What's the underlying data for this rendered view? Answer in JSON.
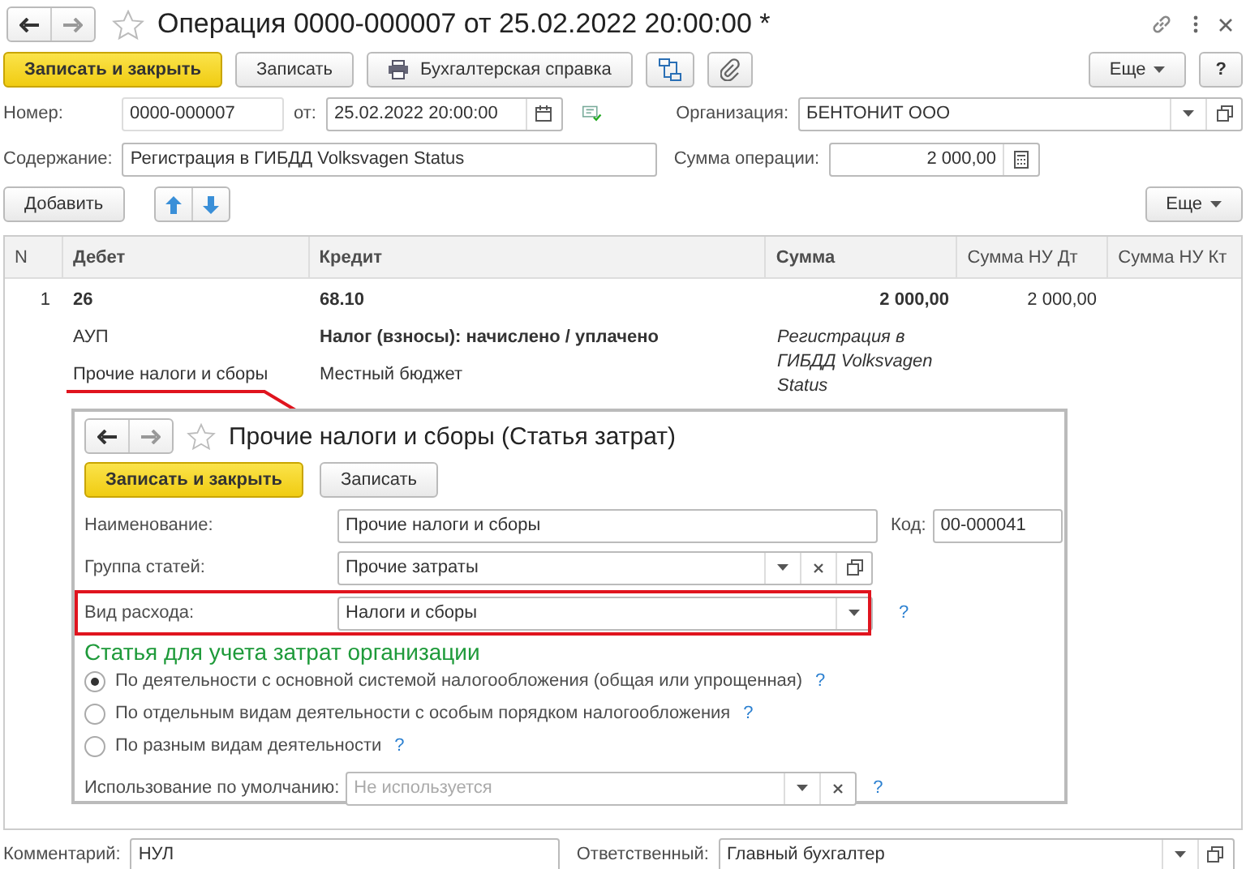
{
  "window": {
    "title": "Операция 0000-000007 от 25.02.2022 20:00:00 *"
  },
  "toolbar": {
    "buttons": [
      {
        "label": "Записать и закрыть",
        "kind": "primary"
      },
      {
        "label": "Записать",
        "kind": "plain"
      },
      {
        "label": "Бухгалтерская справка",
        "kind": "print"
      }
    ],
    "more": "Еще",
    "help": "?"
  },
  "header": {
    "number_label": "Номер:",
    "number": {
      "value": "0000-000007"
    },
    "date_label": "от:",
    "date": {
      "value": "25.02.2022 20:00:00"
    },
    "org_label": "Организация:",
    "org": {
      "value": "БЕНТОНИТ ООО"
    },
    "content_label": "Содержание:",
    "content": {
      "value": "Регистрация в ГИБДД Volksvagen Status"
    },
    "sum_label": "Сумма операции:",
    "sum": {
      "value": "2 000,00"
    }
  },
  "table_toolbar": {
    "add": "Добавить",
    "more": "Еще"
  },
  "table": {
    "columns": [
      "N",
      "Дебет",
      "Кредит",
      "Сумма",
      "Сумма НУ Дт",
      "Сумма НУ Кт"
    ],
    "rows": [
      {
        "n": "1",
        "debit": [
          "26",
          "АУП",
          "Прочие налоги и сборы"
        ],
        "credit": [
          "68.10",
          "Налог (взносы): начислено / уплачено",
          "Местный бюджет"
        ],
        "sum": "2 000,00",
        "description": "Регистрация в ГИБДД Volksvagen Status",
        "sum_nu_dt": "2 000,00"
      }
    ]
  },
  "dialog": {
    "title": "Прочие налоги и сборы (Статья затрат)",
    "buttons": [
      {
        "label": "Записать и закрыть",
        "kind": "primary"
      },
      {
        "label": "Записать",
        "kind": "plain"
      }
    ],
    "fields": [
      {
        "label": "Наименование:",
        "value": "Прочие налоги и сборы",
        "kind": "text",
        "code_label": "Код:",
        "code": "00-000041",
        "highlighted": false
      },
      {
        "label": "Группа статей:",
        "value": "Прочие затраты",
        "kind": "reference",
        "highlighted": false
      },
      {
        "label": "Вид расхода:",
        "value": "Налоги и сборы",
        "kind": "select",
        "help": "?",
        "highlighted": true
      }
    ],
    "section_title": "Статья для учета затрат организации",
    "radios": [
      {
        "label": "По деятельности с основной системой налогообложения (общая или упрощенная)",
        "help": "?",
        "selected": true
      },
      {
        "label": "По отдельным видам деятельности с особым порядком налогообложения",
        "help": "?",
        "selected": false
      },
      {
        "label": "По разным видам деятельности",
        "help": "?",
        "selected": false
      }
    ],
    "default_usage": {
      "label": "Использование по умолчанию:",
      "placeholder": "Не используется",
      "help": "?"
    }
  },
  "footer": {
    "comment_label": "Комментарий:",
    "comment": {
      "value": "НУЛ"
    },
    "responsible_label": "Ответственный:",
    "responsible": {
      "value": "Главный бухгалтер"
    }
  }
}
